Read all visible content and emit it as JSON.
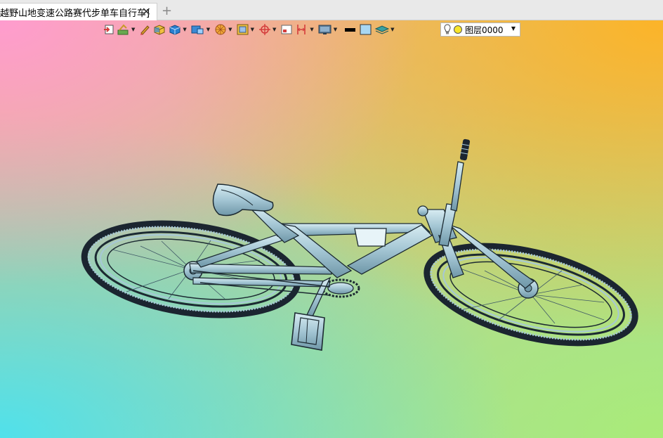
{
  "tab": {
    "title": "越野山地变速公路赛代步单车自行车]",
    "close_glyph": "✕",
    "add_glyph": "+"
  },
  "toolbar": {
    "icons": [
      "exit-sketch-icon",
      "draw-color-icon",
      "pen-icon",
      "shaded-box-icon",
      "shaded-solid-icon",
      "view-mode-icon",
      "render-sphere-icon",
      "frame-view-icon",
      "origin-icon",
      "select-region-icon",
      "dimension-icon",
      "display-icon",
      "line-color-icon",
      "fill-color-icon",
      "layers-icon"
    ],
    "line_color": "#000000",
    "fill_color": "#a9d7f2"
  },
  "layer": {
    "name": "图层0000",
    "bulb_color": "#ffffff",
    "dot_color": "#f7e52a"
  },
  "colors": {
    "bike_body": "#a6c8d6",
    "bike_outline": "#1c2a32",
    "tire": "#1b2530"
  }
}
